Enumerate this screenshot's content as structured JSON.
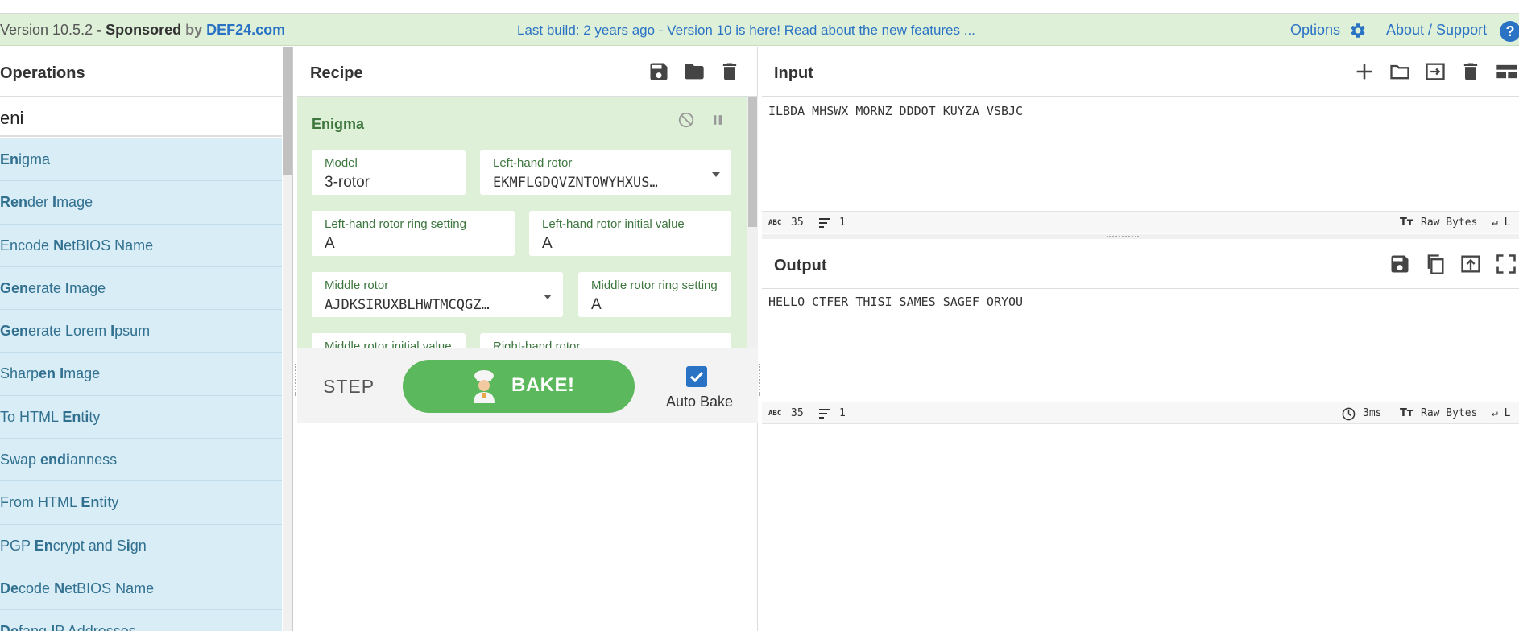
{
  "banner": {
    "version": "Version 10.5.2",
    "dash": " - ",
    "sponsored": "Sponsored",
    "by": " by ",
    "site": "DEF24.com",
    "notice": "Last build: 2 years ago - Version 10 is here! Read about the new features ...",
    "options": "Options",
    "about": "About / Support",
    "help": "?"
  },
  "operations": {
    "title": "Operations",
    "search_value": "eni",
    "items": [
      {
        "pre": "",
        "hl": "En",
        "mid": "igma",
        "hl2": "",
        "post": ""
      },
      {
        "pre": "",
        "hl": "Ren",
        "mid": "der ",
        "hl2": "I",
        "post": "mage"
      },
      {
        "pre": "Encode ",
        "hl": "N",
        "mid": "etBIOS Name",
        "hl2": "",
        "post": ""
      },
      {
        "pre": "",
        "hl": "Gen",
        "mid": "erate ",
        "hl2": "I",
        "post": "mage"
      },
      {
        "pre": "",
        "hl": "Gen",
        "mid": "erate Lorem ",
        "hl2": "I",
        "post": "psum"
      },
      {
        "pre": "Sharp",
        "hl": "en",
        "mid": " ",
        "hl2": "I",
        "post": "mage"
      },
      {
        "pre": "To HTML ",
        "hl": "En",
        "mid": "t",
        "hl2": "i",
        "post": "ty"
      },
      {
        "pre": "Swap ",
        "hl": "endi",
        "mid": "anness",
        "hl2": "",
        "post": ""
      },
      {
        "pre": "From HTML ",
        "hl": "En",
        "mid": "t",
        "hl2": "i",
        "post": "ty"
      },
      {
        "pre": "PGP ",
        "hl": "En",
        "mid": "crypt and S",
        "hl2": "i",
        "post": "gn"
      },
      {
        "pre": "",
        "hl": "De",
        "mid": "code ",
        "hl2": "N",
        "post": "etBIOS Name"
      },
      {
        "pre": "",
        "hl": "De",
        "mid": "fang ",
        "hl2": "I",
        "post": "P Addresses"
      }
    ]
  },
  "recipe": {
    "title": "Recipe",
    "operation": "Enigma",
    "fields": {
      "model": {
        "label": "Model",
        "value": "3-rotor"
      },
      "left_rotor": {
        "label": "Left-hand rotor",
        "value": "EKMFLGDQVZNTOWYHXUS…"
      },
      "left_ring": {
        "label": "Left-hand rotor ring setting",
        "value": "A"
      },
      "left_initial": {
        "label": "Left-hand rotor initial value",
        "value": "A"
      },
      "middle_rotor": {
        "label": "Middle rotor",
        "value": "AJDKSIRUXBLHWTMCQGZ…"
      },
      "middle_ring": {
        "label": "Middle rotor ring setting",
        "value": "A"
      },
      "middle_initial": {
        "label": "Middle rotor initial value",
        "value": ""
      },
      "right_rotor": {
        "label": "Right-hand rotor",
        "value": ""
      }
    },
    "step_label": "STEP",
    "bake_label": "BAKE!",
    "autobake_label": "Auto Bake",
    "autobake_checked": true
  },
  "input": {
    "title": "Input",
    "text": "ILBDA MHSWX MORNZ DDDOT KUYZA VSBJC",
    "length": "35",
    "lines": "1",
    "encoding": "Raw Bytes"
  },
  "output": {
    "title": "Output",
    "text": "HELLO CTFER THISI SAMES SAGEF ORYOU",
    "length": "35",
    "lines": "1",
    "time": "3ms",
    "encoding": "Raw Bytes"
  },
  "colors": {
    "accent": "#2a73c4",
    "banner_bg": "#dff0d8",
    "op_bg": "#d9edf7",
    "bake_green": "#5cb85c",
    "recipe_label_green": "#3c763d"
  }
}
